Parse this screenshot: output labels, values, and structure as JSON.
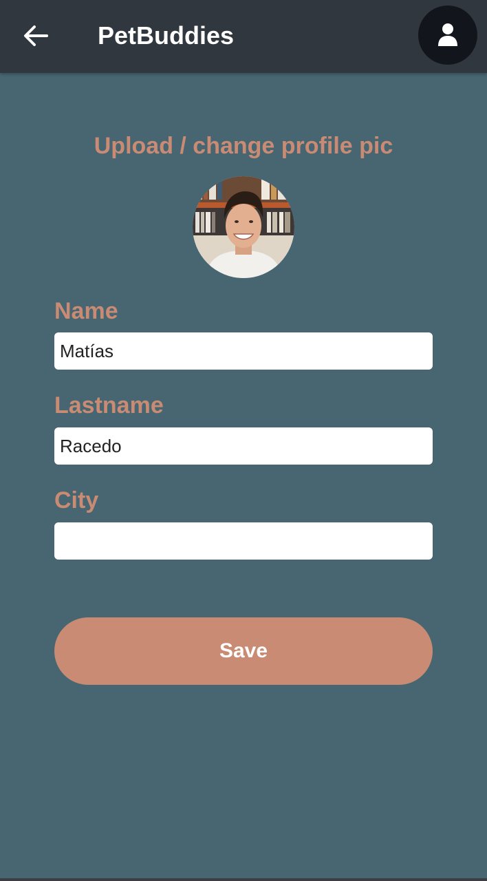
{
  "header": {
    "title": "PetBuddies",
    "back_icon": "arrow-left-icon",
    "profile_icon": "user-icon",
    "background": "#30373f"
  },
  "profile": {
    "upload_label": "Upload / change profile pic",
    "avatar_alt": "profile photo"
  },
  "form": {
    "name_label": "Name",
    "name_value": "Matías",
    "lastname_label": "Lastname",
    "lastname_value": "Racedo",
    "city_label": "City",
    "city_value": ""
  },
  "actions": {
    "save_label": "Save"
  },
  "colors": {
    "background": "#476672",
    "accent": "#c98b73",
    "header": "#30373f"
  }
}
